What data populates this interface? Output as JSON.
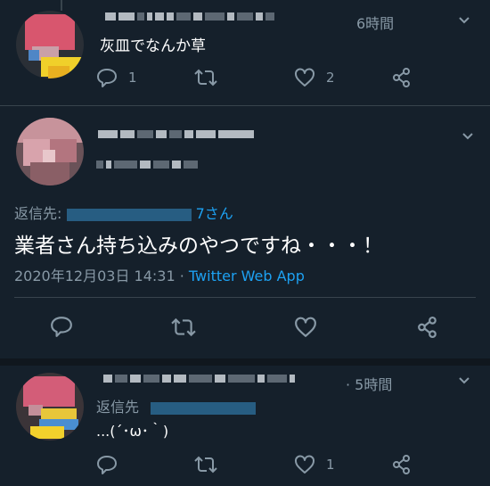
{
  "tweet1": {
    "time": "6時間",
    "text": "灰皿でなんか草",
    "reply_count": "1",
    "like_count": "2"
  },
  "main_tweet": {
    "reply_to_label": "返信先:",
    "reply_to_suffix": "7さん",
    "text": "業者さん持ち込みのやつですね・・・！",
    "timestamp": "2020年12月03日 14:31",
    "separator": "·",
    "source": "Twitter Web App"
  },
  "tweet3": {
    "time": "· 5時間",
    "reply_to_label": "返信先",
    "text": "...(´･ω･｀)",
    "like_count": "1"
  },
  "icons": [
    "reply-icon",
    "retweet-icon",
    "like-icon",
    "share-icon",
    "chevron-down-icon"
  ],
  "colors": {
    "background": "#15202b",
    "divider": "#38444d",
    "muted": "#8899a6",
    "link": "#1da1f2"
  }
}
